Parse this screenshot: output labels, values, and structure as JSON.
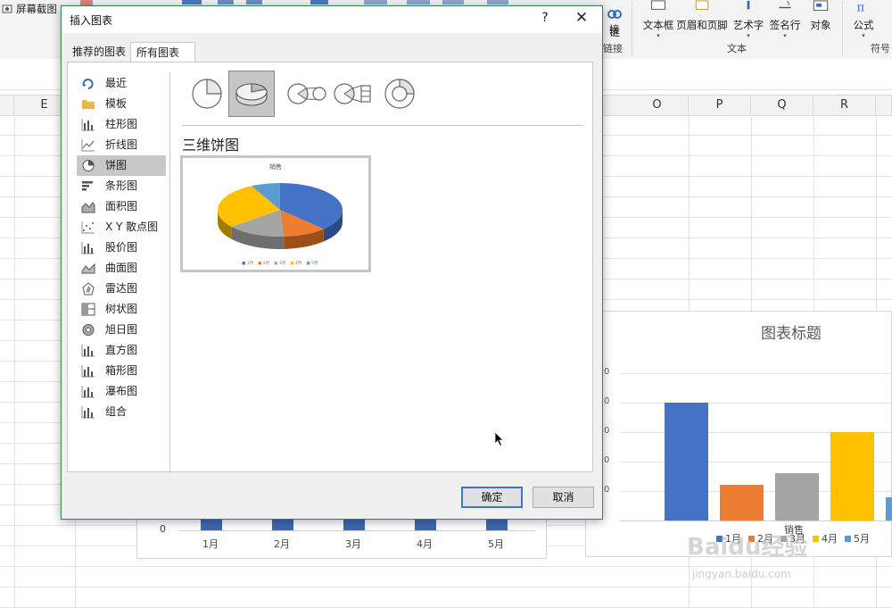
{
  "ribbon": {
    "screenshot_label": "屏幕截图",
    "link_label_1": "链",
    "link_label_2": "接",
    "link_group_label": "链接",
    "textbox_label": "文本框",
    "header_footer_label": "页眉和页脚",
    "wordart_label": "艺术字",
    "signature_label": "签名行",
    "object_label": "对象",
    "text_group_label": "文本",
    "formula_label": "公式",
    "symbols_group_label": "符号"
  },
  "sheet": {
    "columns_left": [
      "E"
    ],
    "columns_right": [
      "O",
      "P",
      "Q",
      "R"
    ]
  },
  "dialog": {
    "title": "插入图表",
    "help": "?",
    "close": "✕",
    "tabs": [
      "推荐的图表",
      "所有图表"
    ],
    "chart_types": [
      "最近",
      "模板",
      "柱形图",
      "折线图",
      "饼图",
      "条形图",
      "面积图",
      "X Y 散点图",
      "股价图",
      "曲面图",
      "雷达图",
      "树状图",
      "旭日图",
      "直方图",
      "箱形图",
      "瀑布图",
      "组合"
    ],
    "selected_type": "饼图",
    "subtype_icons": [
      "pie-icon",
      "3d-pie-icon",
      "pie-of-pie-icon",
      "bar-of-pie-icon",
      "doughnut-icon"
    ],
    "selected_subtype": "3d-pie-icon",
    "subtype_title": "三维饼图",
    "preview_title": "销售",
    "preview_legend": [
      "1月",
      "2月",
      "3月",
      "4月",
      "5月"
    ],
    "ok_label": "确定",
    "cancel_label": "取消"
  },
  "chart_right": {
    "title": "图表标题",
    "series_name": "销售",
    "legend": [
      "1月",
      "2月",
      "3月",
      "4月",
      "5月"
    ]
  },
  "chart_left": {
    "zero_label": "0",
    "x_labels": [
      "1月",
      "2月",
      "3月",
      "4月",
      "5月"
    ]
  },
  "colors": {
    "blue": "#4472c4",
    "orange": "#ed7d31",
    "gray": "#a5a5a5",
    "yellow": "#ffc000",
    "lightblue": "#5b9bd5",
    "dialog_border": "#2f8a4a"
  },
  "chart_data": [
    {
      "type": "bar",
      "title": "图表标题",
      "categories": [
        "1月",
        "2月",
        "3月",
        "4月",
        "5月"
      ],
      "series": [
        {
          "name": "销售",
          "values": [
            80,
            24,
            32,
            60,
            16
          ]
        }
      ]
    },
    {
      "type": "pie",
      "title": "销售",
      "categories": [
        "1月",
        "2月",
        "3月",
        "4月",
        "5月"
      ],
      "values": [
        80,
        24,
        32,
        60,
        16
      ]
    }
  ],
  "watermark": {
    "text": "Baidu经验",
    "url": "jingyan.baidu.com"
  }
}
